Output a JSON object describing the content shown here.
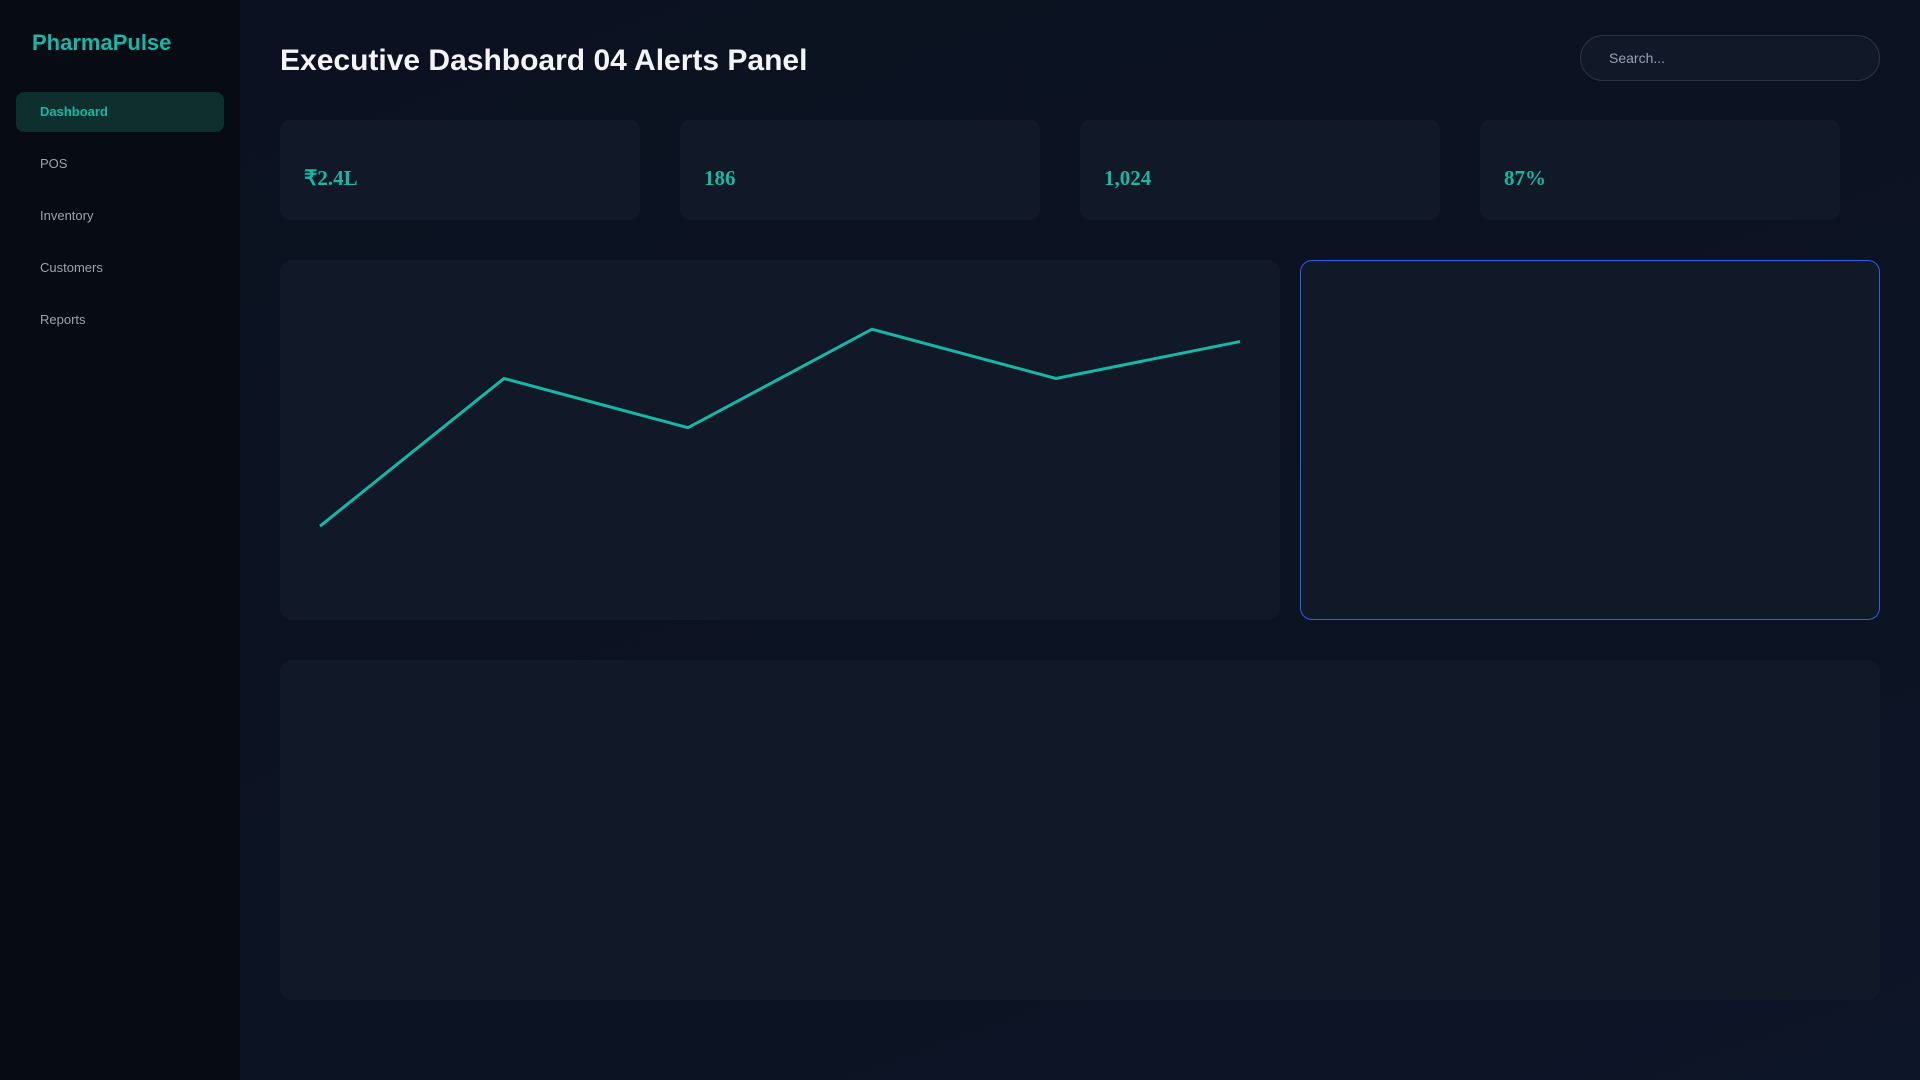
{
  "app": {
    "brand": "PharmaPulse"
  },
  "sidebar": {
    "items": [
      {
        "label": "Dashboard",
        "active": true
      },
      {
        "label": "POS",
        "active": false
      },
      {
        "label": "Inventory",
        "active": false
      },
      {
        "label": "Customers",
        "active": false
      },
      {
        "label": "Reports",
        "active": false
      }
    ]
  },
  "header": {
    "title": "Executive Dashboard 04 Alerts Panel",
    "search_placeholder": "Search..."
  },
  "kpis": [
    {
      "value": "₹2.4L"
    },
    {
      "value": "186"
    },
    {
      "value": "1,024"
    },
    {
      "value": "87%"
    }
  ],
  "colors": {
    "accent": "#14b8a6",
    "highlight_border": "#2563eb",
    "panel": "#111827",
    "background": "#0b1120"
  },
  "chart_data": {
    "type": "line",
    "x": [
      1,
      2,
      3,
      4,
      5,
      6
    ],
    "series": [
      {
        "values": [
          30,
          90,
          70,
          110,
          90,
          105
        ],
        "color": "#14b8a6"
      }
    ],
    "ylim": [
      0,
      130
    ],
    "grid": false
  }
}
